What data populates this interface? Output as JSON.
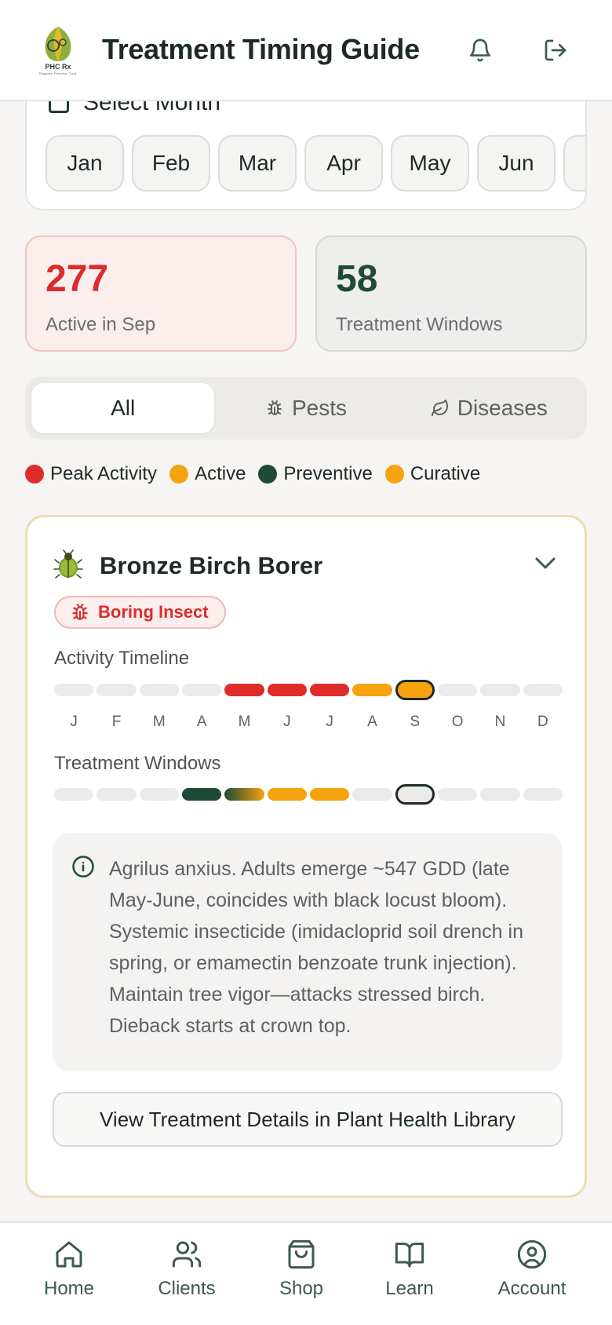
{
  "header": {
    "title": "Treatment Timing Guide",
    "logo_text": "PHC Rx",
    "logo_tagline": "Diagnose. Prescribe. Treat."
  },
  "month_selector": {
    "label": "Select Month",
    "months": [
      "Jan",
      "Feb",
      "Mar",
      "Apr",
      "May",
      "Jun"
    ]
  },
  "stats": {
    "active": {
      "value": "277",
      "label": "Active in Sep"
    },
    "windows": {
      "value": "58",
      "label": "Treatment Windows"
    }
  },
  "tabs": [
    {
      "label": "All",
      "icon": "grid-icon"
    },
    {
      "label": "Pests",
      "icon": "bug-icon"
    },
    {
      "label": "Diseases",
      "icon": "leaf-icon"
    }
  ],
  "legend": [
    {
      "label": "Peak Activity",
      "color": "#e02b2b"
    },
    {
      "label": "Active",
      "color": "#f5a30f"
    },
    {
      "label": "Preventive",
      "color": "#1f4a38"
    },
    {
      "label": "Curative",
      "color": "#f5a30f"
    }
  ],
  "pest": {
    "name": "Bronze Birch Borer",
    "badge": "Boring Insect",
    "activity_label": "Activity Timeline",
    "treatment_label": "Treatment Windows",
    "month_letters": [
      "J",
      "F",
      "M",
      "A",
      "M",
      "J",
      "J",
      "A",
      "S",
      "O",
      "N",
      "D"
    ],
    "current_month_index": 8,
    "activity": [
      "none",
      "none",
      "none",
      "none",
      "peak",
      "peak",
      "peak",
      "active",
      "active",
      "none",
      "none",
      "none"
    ],
    "treatment": [
      "none",
      "none",
      "none",
      "preventive",
      "transition",
      "curative",
      "curative",
      "none",
      "none",
      "none",
      "none",
      "none"
    ],
    "info": "Agrilus anxius. Adults emerge ~547 GDD (late May-June, coincides with black locust bloom). Systemic insecticide (imidacloprid soil drench in spring, or emamectin benzoate trunk injection). Maintain tree vigor—attacks stressed birch. Dieback starts at crown top.",
    "button_label": "View Treatment Details in Plant Health Library"
  },
  "colors": {
    "none": "#ebebe9",
    "peak": "#e02b2b",
    "active": "#f5a30f",
    "preventive": "#1f4a38",
    "curative": "#f5a30f"
  },
  "bottom_nav": [
    {
      "label": "Home",
      "icon": "home-icon"
    },
    {
      "label": "Clients",
      "icon": "users-icon"
    },
    {
      "label": "Shop",
      "icon": "bag-icon"
    },
    {
      "label": "Learn",
      "icon": "book-icon"
    },
    {
      "label": "Account",
      "icon": "account-icon"
    }
  ]
}
